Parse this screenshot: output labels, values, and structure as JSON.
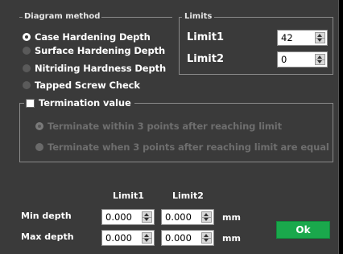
{
  "diagram_method": {
    "title": "Diagram method",
    "options": [
      {
        "label": "Case Hardening Depth",
        "selected": true
      },
      {
        "label": "Surface Hardening Depth",
        "selected": false
      },
      {
        "label": "Nitriding Hardness Depth",
        "selected": false
      },
      {
        "label": "Tapped Screw Check",
        "selected": false
      }
    ]
  },
  "limits": {
    "title": "Limits",
    "limit1_label": "Limit1",
    "limit1_value": "42",
    "limit2_label": "Limit2",
    "limit2_value": "0"
  },
  "termination": {
    "checkbox_label": "Termination value",
    "checked": false,
    "options": [
      {
        "label": "Terminate within 3 points after reaching limit",
        "selected": true
      },
      {
        "label": "Terminate when 3 points after reaching limit are equal",
        "selected": false
      }
    ]
  },
  "depth_table": {
    "col1": "Limit1",
    "col2": "Limit2",
    "min_label": "Min depth",
    "max_label": "Max depth",
    "min_limit1": "0.000",
    "min_limit2": "0.000",
    "max_limit1": "0.000",
    "max_limit2": "0.000",
    "unit": "mm"
  },
  "ok_label": "Ok",
  "colors": {
    "background": "#3a3a3a",
    "ok_button": "#1aa84c"
  }
}
